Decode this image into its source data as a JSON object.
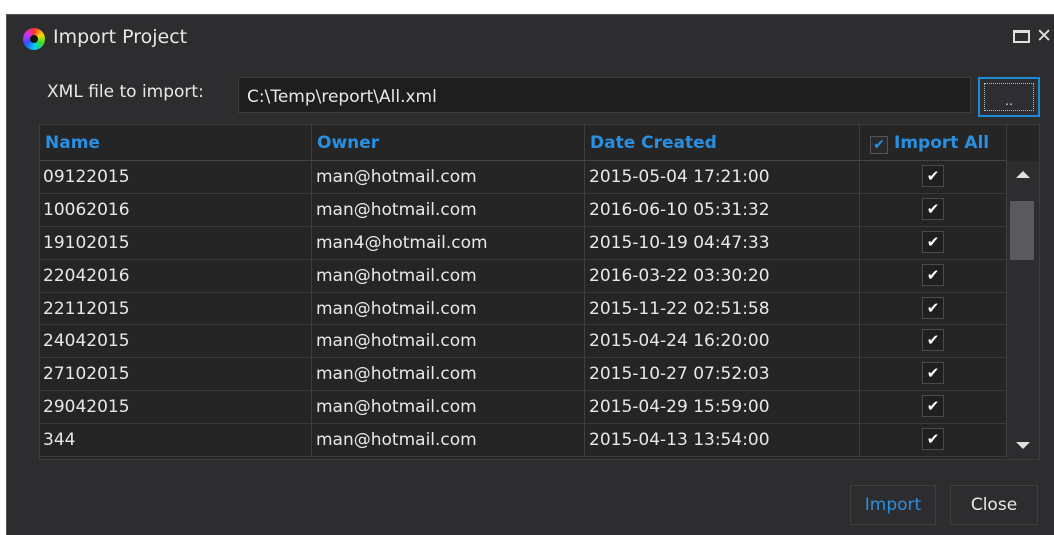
{
  "window": {
    "title": "Import Project"
  },
  "file": {
    "label": "XML file to import:",
    "path": "C:\\Temp\\report\\All.xml",
    "browse_label": ".."
  },
  "table": {
    "headers": {
      "name": "Name",
      "owner": "Owner",
      "date": "Date Created",
      "import_all": "Import All",
      "import_all_checked": true
    },
    "check_glyph": "✔",
    "rows": [
      {
        "name": "09122015",
        "owner": "man@hotmail.com",
        "date": "2015-05-04 17:21:00",
        "checked": true
      },
      {
        "name": "10062016",
        "owner": "man@hotmail.com",
        "date": "2016-06-10 05:31:32",
        "checked": true
      },
      {
        "name": "19102015",
        "owner": "man4@hotmail.com",
        "date": "2015-10-19 04:47:33",
        "checked": true
      },
      {
        "name": "22042016",
        "owner": "man@hotmail.com",
        "date": "2016-03-22 03:30:20",
        "checked": true
      },
      {
        "name": "22112015",
        "owner": "man@hotmail.com",
        "date": "2015-11-22 02:51:58",
        "checked": true
      },
      {
        "name": "24042015",
        "owner": "man@hotmail.com",
        "date": "2015-04-24 16:20:00",
        "checked": true
      },
      {
        "name": "27102015",
        "owner": "man@hotmail.com",
        "date": "2015-10-27 07:52:03",
        "checked": true
      },
      {
        "name": "29042015",
        "owner": "man@hotmail.com",
        "date": "2015-04-29 15:59:00",
        "checked": true
      },
      {
        "name": "344",
        "owner": "man@hotmail.com",
        "date": "2015-04-13 13:54:00",
        "checked": true
      }
    ]
  },
  "buttons": {
    "import": "Import",
    "close": "Close"
  },
  "colors": {
    "accent": "#2a8fe0",
    "background": "#2d2d30",
    "grid": "#252526",
    "text": "#e8e8e8"
  },
  "icons": {
    "app": "color-wheel-icon",
    "maximize": "maximize-icon",
    "close": "close-icon",
    "scroll_up": "arrow-up-icon",
    "scroll_down": "arrow-down-icon"
  }
}
